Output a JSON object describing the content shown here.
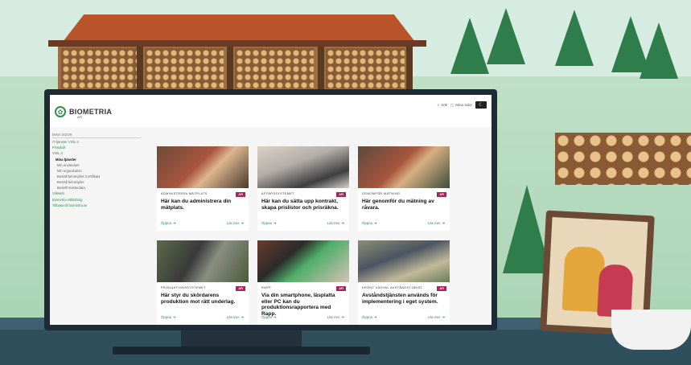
{
  "brand": {
    "name": "BIOMETRIA",
    "sub": "AFI",
    "mark": "logo-icon"
  },
  "header": {
    "search_label": "Sök",
    "pages_label": "Mina sidor",
    "mode_icon": "moon-icon"
  },
  "sidebar": {
    "heading": "MINA SIDOR",
    "items": [
      {
        "label": "IT-tjänster VIOL 3",
        "type": "link"
      },
      {
        "label": "Protokoll",
        "type": "link"
      },
      {
        "label": "VIOL 3",
        "type": "link"
      },
      {
        "label": "Mina tjänster",
        "type": "active"
      },
      {
        "label": "Min användare",
        "type": "sub"
      },
      {
        "label": "Min organisation",
        "type": "sub"
      },
      {
        "label": "Beställ behörighet Certifikats",
        "type": "sub"
      },
      {
        "label": "Beställ behörighet",
        "type": "sub"
      },
      {
        "label": "Beställ masterdata",
        "type": "sub"
      },
      {
        "label": "Virkweb",
        "type": "link"
      },
      {
        "label": "Biometria Utbildning",
        "type": "link"
      },
      {
        "label": "Tillbaka till biometria.se",
        "type": "link"
      }
    ]
  },
  "cards": [
    {
      "category": "ADMINISTRERA MÄTPLATS",
      "badge": "AFI",
      "title": "Här kan du administrera din mätplats.",
      "open": "Öppna",
      "more": "Läs mer"
    },
    {
      "category": "AFFÄRSSYSTEMET",
      "badge": "AFI",
      "title": "Här kan du sätta upp kontrakt, skapa prislistor och prisräkna.",
      "open": "Öppna",
      "more": "Läs mer"
    },
    {
      "category": "GENOMFÖR MÄTNING",
      "badge": "AFI",
      "title": "Här genomför du mätning av råvara.",
      "open": "Öppna",
      "more": "Läs mer"
    },
    {
      "category": "PRODUKTIONSSYSTEMET",
      "badge": "AFI",
      "title": "Här styr du skördarens produktion mot rätt underlag.",
      "open": "Öppna",
      "more": "Läs mer"
    },
    {
      "category": "RAPP",
      "badge": "AFI",
      "title": "Via din smartphone, läsplatta eller PC kan du produktionsrapportera med Rapp.",
      "open": "Öppna",
      "more": "Läs mer"
    },
    {
      "category": "KRÖNT VÄGVAL AVSTÅNDSTJÄNST",
      "badge": "AFI",
      "title": "Avståndstjänsten används för implementering i eget system.",
      "open": "Öppna",
      "more": "Läs mer"
    }
  ],
  "colors": {
    "brand_green": "#2f8f4e",
    "badge": "#a1265a"
  }
}
